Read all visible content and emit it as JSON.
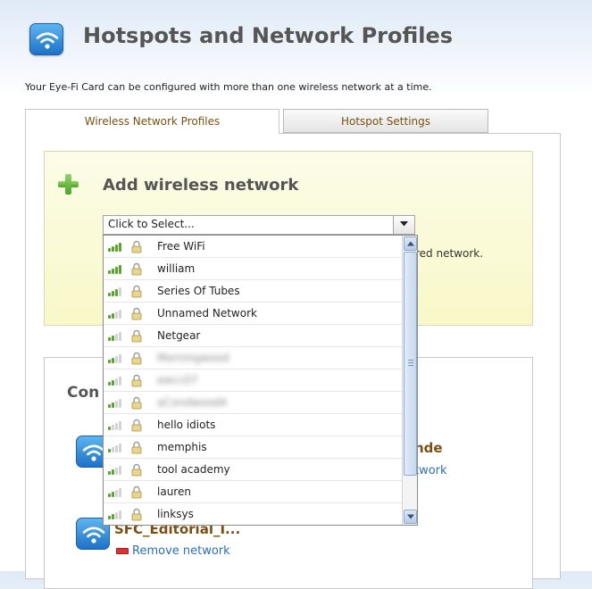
{
  "header": {
    "title": "Hotspots and Network Profiles",
    "intro": "Your Eye-Fi Card can be configured with more than one wireless network at a time."
  },
  "tabs": [
    {
      "label": "Wireless Network Profiles",
      "active": true
    },
    {
      "label": "Hotspot Settings",
      "active": false
    }
  ],
  "add_network": {
    "title": "Add wireless network",
    "select": {
      "value": "Click to Select..."
    },
    "hint_text": "red network."
  },
  "dropdown": {
    "options": [
      {
        "label": "Free WiFi",
        "signal_bars": 4,
        "locked": true,
        "obscured": false
      },
      {
        "label": "william",
        "signal_bars": 4,
        "locked": true,
        "obscured": false
      },
      {
        "label": "Series Of Tubes",
        "signal_bars": 3,
        "locked": true,
        "obscured": false
      },
      {
        "label": "Unnamed Network",
        "signal_bars": 2,
        "locked": true,
        "obscured": false
      },
      {
        "label": "Netgear",
        "signal_bars": 2,
        "locked": true,
        "obscured": false
      },
      {
        "label": "Morningwood",
        "signal_bars": 2,
        "locked": true,
        "obscured": true
      },
      {
        "label": "ewcc07",
        "signal_bars": 2,
        "locked": true,
        "obscured": true
      },
      {
        "label": "aCondwood4",
        "signal_bars": 2,
        "locked": true,
        "obscured": true
      },
      {
        "label": "hello idiots",
        "signal_bars": 1,
        "locked": true,
        "obscured": false
      },
      {
        "label": "memphis",
        "signal_bars": 1,
        "locked": true,
        "obscured": false
      },
      {
        "label": "tool academy",
        "signal_bars": 2,
        "locked": true,
        "obscured": false
      },
      {
        "label": "lauren",
        "signal_bars": 2,
        "locked": true,
        "obscured": false
      },
      {
        "label": "linksys",
        "signal_bars": 2,
        "locked": true,
        "obscured": false
      }
    ]
  },
  "configured": {
    "title_visible": "Con",
    "networks": [
      {
        "name_visible": "nde",
        "link_visible": "twork"
      },
      {
        "name_visible": "SFC_Editorial_I...",
        "link": "Remove network"
      }
    ]
  },
  "colors": {
    "tab_text": "#7a4f12",
    "link": "#2a6fb5",
    "signal_on": "#5aa62c",
    "signal_off": "#d3d3d3",
    "panel_yellow": "#f8f8c8"
  },
  "icons": {
    "app": "wifi-icon",
    "add": "plus-icon",
    "network": "wifi-icon",
    "remove": "remove-icon",
    "signal": "signal-strength-icon",
    "lock": "lock-icon"
  }
}
